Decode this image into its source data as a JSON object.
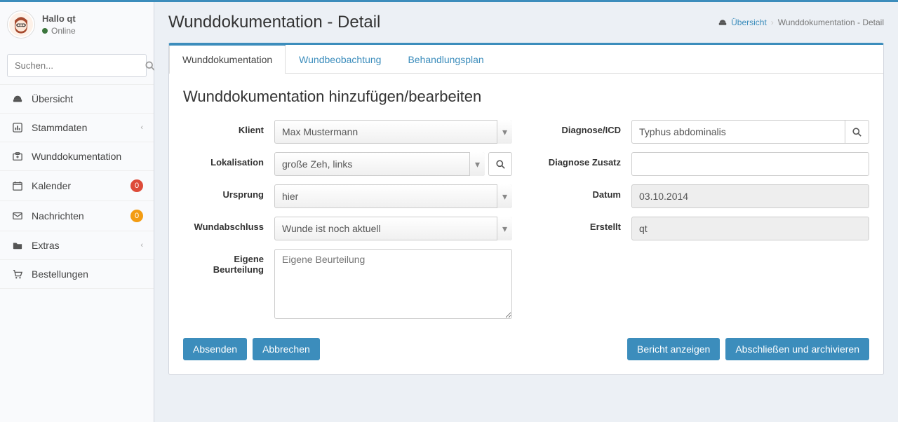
{
  "user": {
    "greeting": "Hallo qt",
    "status": "Online"
  },
  "search": {
    "placeholder": "Suchen..."
  },
  "nav": {
    "uebersicht": "Übersicht",
    "stammdaten": "Stammdaten",
    "wunddok": "Wunddokumentation",
    "kalender": "Kalender",
    "kalender_badge": "0",
    "nachrichten": "Nachrichten",
    "nachrichten_badge": "0",
    "extras": "Extras",
    "bestellungen": "Bestellungen"
  },
  "header": {
    "title": "Wunddokumentation - Detail"
  },
  "breadcrumb": {
    "home": "Übersicht",
    "current": "Wunddokumentation - Detail"
  },
  "tabs": {
    "wunddok": "Wunddokumentation",
    "wundbeob": "Wundbeobachtung",
    "behandlung": "Behandlungsplan"
  },
  "form": {
    "heading": "Wunddokumentation hinzufügen/bearbeiten",
    "labels": {
      "klient": "Klient",
      "lokalisation": "Lokalisation",
      "ursprung": "Ursprung",
      "wundabschluss": "Wundabschluss",
      "eigene_beurteilung": "Eigene Beurteilung",
      "diagnose": "Diagnose/ICD",
      "diagnose_zusatz": "Diagnose Zusatz",
      "datum": "Datum",
      "erstellt": "Erstellt"
    },
    "values": {
      "klient": "Max Mustermann",
      "lokalisation": "große Zeh, links",
      "ursprung": "hier",
      "wundabschluss": "Wunde ist noch aktuell",
      "eigene_beurteilung": "",
      "eigene_beurteilung_placeholder": "Eigene Beurteilung",
      "diagnose": "Typhus abdominalis",
      "diagnose_zusatz": "",
      "datum": "03.10.2014",
      "erstellt": "qt"
    }
  },
  "buttons": {
    "absenden": "Absenden",
    "abbrechen": "Abbrechen",
    "bericht": "Bericht anzeigen",
    "abschliessen": "Abschließen und archivieren"
  }
}
